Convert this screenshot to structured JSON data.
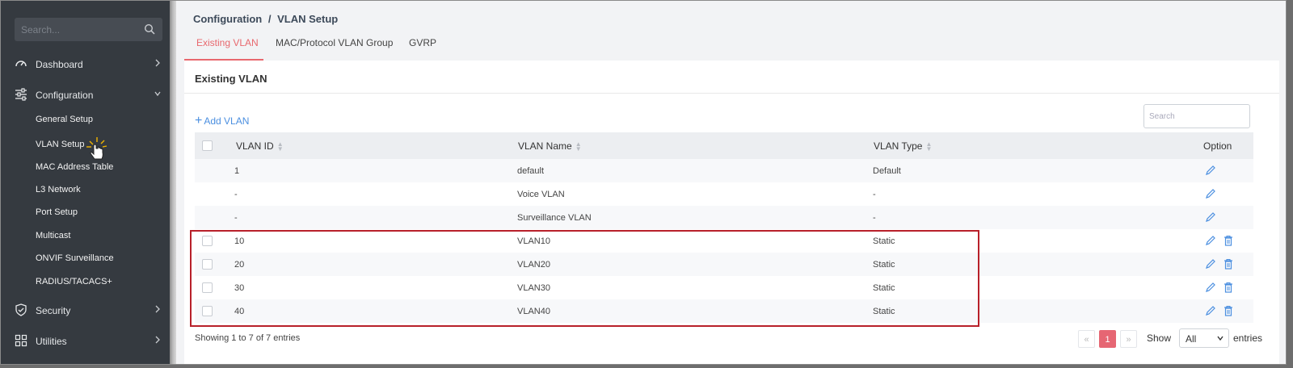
{
  "sidebar": {
    "search_placeholder": "Search...",
    "items": [
      {
        "label": "Dashboard",
        "icon": "dashboard-gauge-icon"
      },
      {
        "label": "Configuration",
        "icon": "sliders-icon"
      },
      {
        "label": "Security",
        "icon": "shield-icon"
      },
      {
        "label": "Utilities",
        "icon": "grid-icon"
      }
    ],
    "config_sub": [
      "General Setup",
      "VLAN Setup",
      "MAC Address Table",
      "L3 Network",
      "Port Setup",
      "Multicast",
      "ONVIF Surveillance",
      "RADIUS/TACACS+"
    ]
  },
  "breadcrumb": {
    "parent": "Configuration",
    "separator": "/",
    "current": "VLAN Setup"
  },
  "tabs": [
    "Existing VLAN",
    "MAC/Protocol VLAN Group",
    "GVRP"
  ],
  "panel": {
    "title": "Existing VLAN",
    "add_label": "Add VLAN",
    "search_placeholder": "Search",
    "columns": [
      "VLAN ID",
      "VLAN Name",
      "VLAN Type",
      "Option"
    ],
    "rows": [
      {
        "id": "1",
        "name": "default",
        "type": "Default"
      },
      {
        "id": "-",
        "name": "Voice VLAN",
        "type": "-"
      },
      {
        "id": "-",
        "name": "Surveillance VLAN",
        "type": "-"
      },
      {
        "id": "10",
        "name": "VLAN10",
        "type": "Static"
      },
      {
        "id": "20",
        "name": "VLAN20",
        "type": "Static"
      },
      {
        "id": "30",
        "name": "VLAN30",
        "type": "Static"
      },
      {
        "id": "40",
        "name": "VLAN40",
        "type": "Static"
      }
    ],
    "info": "Showing 1 to 7 of 7 entries",
    "pager": {
      "prev": "«",
      "page": "1",
      "next": "»"
    },
    "show_label": "Show",
    "show_value": "All",
    "entries_label": "entries"
  },
  "colors": {
    "accent": "#e8686e",
    "sidebar_bg": "#353a40",
    "link": "#4b8fe0",
    "highlight": "#b8202a"
  }
}
